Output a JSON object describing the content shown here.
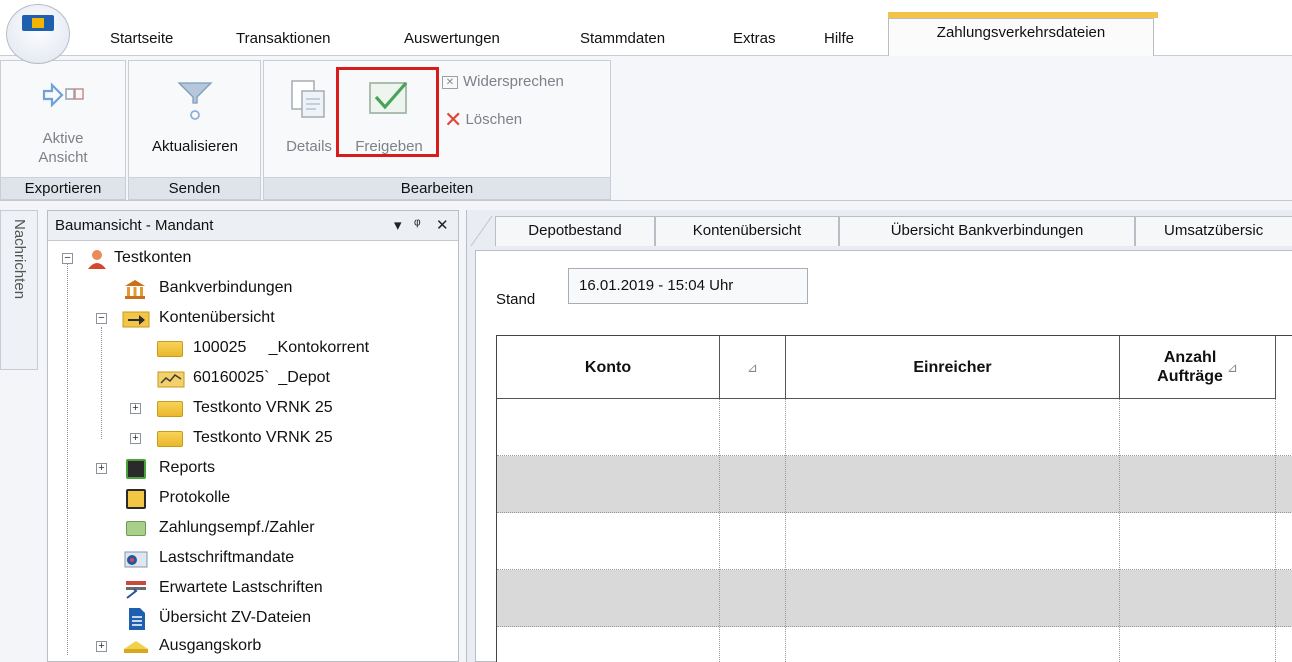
{
  "menu": {
    "items": [
      "Startseite",
      "Transaktionen",
      "Auswertungen",
      "Stammdaten",
      "Extras",
      "Hilfe"
    ],
    "active_tab": "Zahlungsverkehrsdateien"
  },
  "ribbon": {
    "groups": {
      "exportieren": {
        "label": "Exportieren",
        "aktive_ansicht_line1": "Aktive",
        "aktive_ansicht_line2": "Ansicht"
      },
      "senden": {
        "label": "Senden",
        "aktualisieren": "Aktualisieren"
      },
      "bearbeiten": {
        "label": "Bearbeiten",
        "details": "Details",
        "freigeben": "Freigeben",
        "widersprechen": "Widersprechen",
        "loeschen": "Löschen"
      }
    }
  },
  "side_tab": {
    "label": "Nachrichten"
  },
  "tree": {
    "title": "Baumansicht - Mandant",
    "controls": {
      "dropdown": "▾",
      "pin": "ᵠ",
      "close": "✕"
    },
    "nodes": {
      "root": "Testkonten",
      "bankverbindungen": "Bankverbindungen",
      "kontenuebersicht": "Kontenübersicht",
      "konto1": "100025     _Kontokorrent",
      "konto2": "60160025`  _Depot",
      "konto3": "Testkonto VRNK 25",
      "konto4": "Testkonto VRNK 25",
      "reports": "Reports",
      "protokolle": "Protokolle",
      "zahlungsempf": "Zahlungsempf./Zahler",
      "lastschriftmandate": "Lastschriftmandate",
      "erwartete": "Erwartete Lastschriften",
      "uebersicht_zv": "Übersicht ZV-Dateien",
      "ausgangskorb": "Ausgangskorb"
    }
  },
  "doc_tabs": [
    "Depotbestand",
    "Kontenübersicht",
    "Übersicht Bankverbindungen",
    "Umsatzübersic"
  ],
  "stand": {
    "label": "Stand",
    "value": "16.01.2019 - 15:04 Uhr"
  },
  "grid": {
    "headers": {
      "konto": "Konto",
      "einreicher": "Einreicher",
      "anzahl_line1": "Anzahl",
      "anzahl_line2": "Aufträge"
    },
    "sort_icon": "⊿"
  }
}
